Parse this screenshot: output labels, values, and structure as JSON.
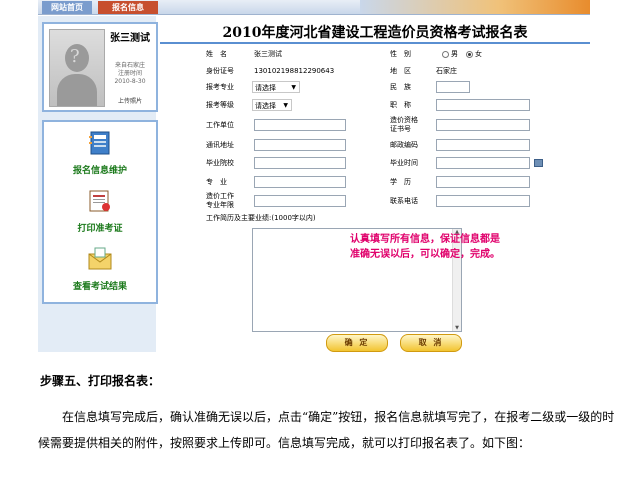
{
  "nav": {
    "home": "网站首页",
    "register": "报名信息"
  },
  "profile": {
    "name": "张三测试",
    "from": "来自石家庄",
    "reg_label": "注册时间",
    "reg_date": "2010-8-30",
    "upload": "上传照片"
  },
  "menu": {
    "items": [
      {
        "label": "报名信息维护",
        "icon": "address-book-icon"
      },
      {
        "label": "打印准考证",
        "icon": "certificate-icon"
      },
      {
        "label": "查看考试结果",
        "icon": "envelope-icon"
      }
    ]
  },
  "form": {
    "title": "2010年度河北省建设工程造价员资格考试报名表",
    "name_label": "姓　名",
    "name_value": "张三测试",
    "gender_label": "性　别",
    "gender_options": [
      "男",
      "女"
    ],
    "gender_selected": "女",
    "id_label": "身份证号",
    "id_value": "130102198812290643",
    "region_label": "地　区",
    "region_value": "石家庄",
    "major_label": "报考专业",
    "major_value": "请选择",
    "ethnic_label": "民　族",
    "level_label": "报考等级",
    "level_value": "请选择",
    "title_label": "职　称",
    "employer_label": "工作单位",
    "cert_label": "造价资格证书号",
    "address_label": "通讯地址",
    "postal_label": "邮政编码",
    "school_label": "毕业院校",
    "gradtime_label": "毕业时间",
    "specialty_label": "专　业",
    "degree_label": "学　历",
    "years_label": "造价工作专业年限",
    "phone_label": "联系电话",
    "resume_label": "工作简历及主要业绩:(1000字以内)",
    "note_line1": "认真填写所有信息，保证信息都是",
    "note_line2": "准确无误以后，可以确定，完成。",
    "confirm": "确 定",
    "cancel": "取 消"
  },
  "article": {
    "heading": "步骤五、打印报名表：",
    "paragraph": "在信息填写完成后，确认准确无误以后，点击“确定”按钮，报名信息就填写完了，在报考二级或一级的时候需要提供相关的附件，按照要求上传即可。信息填写完成，就可以打印报名表了。如下图："
  }
}
